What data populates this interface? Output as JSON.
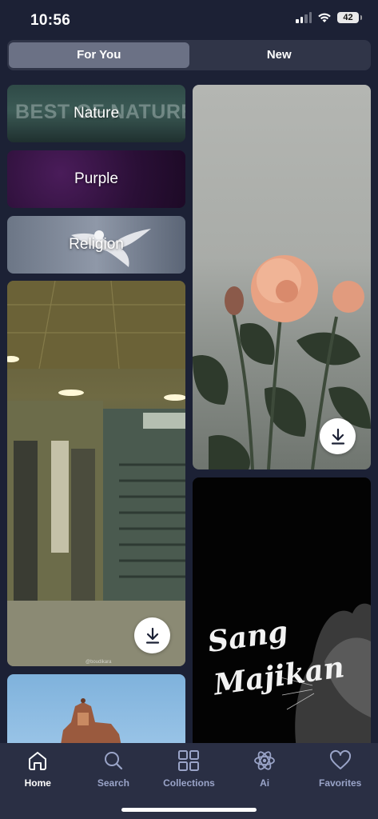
{
  "status_bar": {
    "time": "10:56",
    "battery_level": "42",
    "icons": [
      "cellular-signal-icon",
      "wifi-icon",
      "battery-icon"
    ]
  },
  "segments": {
    "for_you": "For You",
    "new": "New",
    "selected": "For You"
  },
  "categories": {
    "nature": "Nature",
    "nature_watermark": "BEST OF NATURE",
    "purple": "Purple",
    "religion": "Religion"
  },
  "wallpapers": {
    "cat_text": "Sang Majikan",
    "subway_credit": "@boudikara"
  },
  "tab_bar": {
    "home": "Home",
    "search": "Search",
    "collections": "Collections",
    "ai": "Ai",
    "favorites": "Favorites",
    "active": "Home"
  },
  "colors": {
    "background": "#1c2135",
    "tab_bar": "#2a2f44",
    "active_segment": "#6b7185",
    "inactive_tab": "#9aa4c8"
  }
}
